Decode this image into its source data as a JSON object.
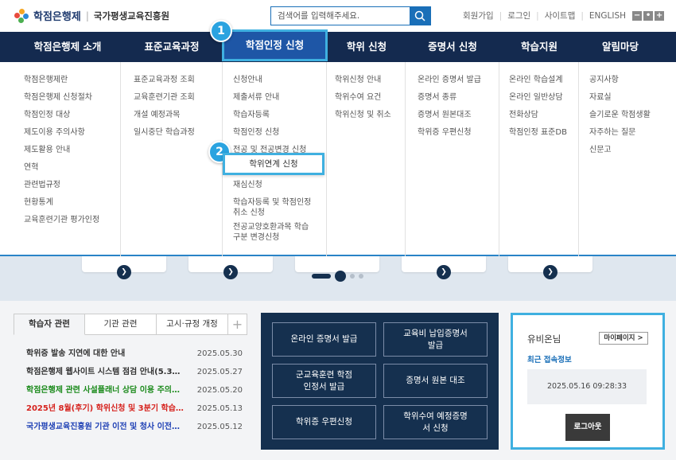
{
  "header": {
    "logo_name": "학점은행제",
    "logo_org": "국가평생교육진흥원",
    "search_placeholder": "검색어를 입력해주세요.",
    "util": [
      "회원가입",
      "로그인",
      "사이트맵",
      "ENGLISH"
    ],
    "zoom": [
      "−",
      "•",
      "+"
    ]
  },
  "nav": {
    "items": [
      "학점은행제 소개",
      "표준교육과정",
      "학점인정 신청",
      "학위 신청",
      "증명서 신청",
      "학습지원",
      "알림마당"
    ],
    "active_index": 2
  },
  "mega": {
    "col1": [
      "학점은행제란",
      "학점은행제 신청절차",
      "학점인정 대상",
      "제도이용 주의사항",
      "제도활용 안내",
      "연혁",
      "관련법규정",
      "현황통계",
      "교육훈련기관 평가인정"
    ],
    "col2": [
      "표준교육과정 조회",
      "교육훈련기관 조회",
      "개설 예정과목",
      "일시중단 학습과정"
    ],
    "col3": [
      "신청안내",
      "제출서류 안내",
      "학습자등록",
      "학점인정 신청",
      "전공 및 전공변경 신청",
      "",
      "재심신청",
      "학습자등록 및 학점인정 취소 신청",
      "전공교양호환과목 학습구분 변경신청"
    ],
    "col4": [
      "학위신청 안내",
      "학위수여 요건",
      "학위신청 및 취소"
    ],
    "col5": [
      "온라인 증명서 발급",
      "증명서 종류",
      "증명서 원본대조",
      "학위증 우편신청"
    ],
    "col6": [
      "온라인 학습설계",
      "온라인 일반상담",
      "전화상담",
      "학점인정 표준DB"
    ],
    "col7": [
      "공지사항",
      "자료실",
      "슬기로운 학점생활",
      "자주하는 질문",
      "신문고"
    ]
  },
  "callouts": {
    "badge1": "1",
    "badge2": "2",
    "popup_label": "학위연계 신청"
  },
  "notice": {
    "tabs": [
      "학습자 관련",
      "기관 관련",
      "고시·규정 개정",
      "+"
    ],
    "rows": [
      {
        "title": "학위증 발송 지연에 대한 안내",
        "date": "2025.05.30",
        "color": "#333333"
      },
      {
        "title": "학점은행제 웹사이트 시스템 점검 안내(5.3…",
        "date": "2025.05.27",
        "color": "#333333"
      },
      {
        "title": "학점은행제 관련 사설플래너 상담 이용 주의…",
        "date": "2025.05.20",
        "color": "#1b8a1b"
      },
      {
        "title": "2025년 8월(후기) 학위신청 및 3분기 학습…",
        "date": "2025.05.13",
        "color": "#d6231e"
      },
      {
        "title": "국가평생교육진흥원 기관 이전 및 청사 이전…",
        "date": "2025.05.12",
        "color": "#1d3fb4"
      }
    ]
  },
  "quick": {
    "buttons": [
      "온라인 증명서 발급",
      "교육비 납입증명서 발급",
      "군교육훈련 학점인정서 발급",
      "증명서 원본 대조",
      "학위증 우편신청",
      "학위수여 예정증명서 신청"
    ]
  },
  "login": {
    "name": "유비온님",
    "mypage": "마이페이지 >",
    "recent_label": "최근 접속정보",
    "recent_date": "2025.05.16 09:28:33",
    "logout": "로그아웃"
  },
  "colors": {
    "nav_bg": "#142a4f",
    "accent": "#3fb0e0",
    "active_nav": "#1e56a6"
  }
}
